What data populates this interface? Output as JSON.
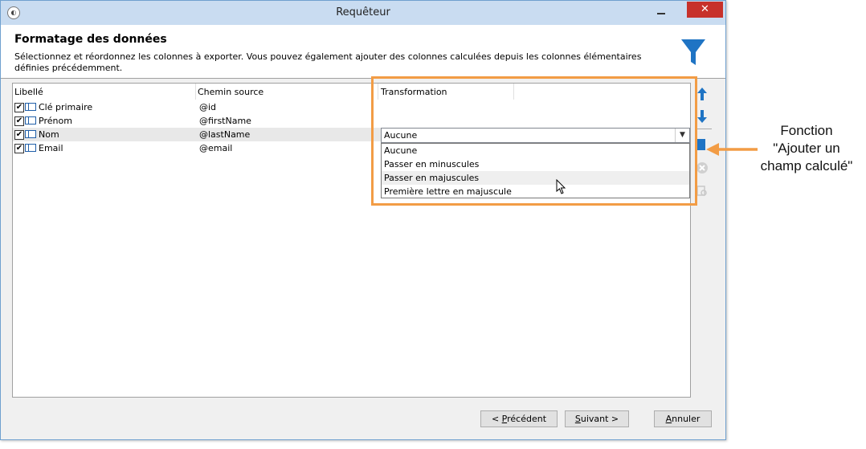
{
  "window": {
    "title": "Requêteur",
    "close_glyph": "✕"
  },
  "header": {
    "title": "Formatage des données",
    "description": "Sélectionnez et réordonnez les colonnes à exporter. Vous pouvez également ajouter des colonnes calculées depuis les colonnes élémentaires définies précédemment."
  },
  "grid": {
    "columns": [
      "Libellé",
      "Chemin source",
      "Transformation"
    ],
    "rows": [
      {
        "label": "Clé primaire",
        "path": "@id",
        "checked": true
      },
      {
        "label": "Prénom",
        "path": "@firstName",
        "checked": true
      },
      {
        "label": "Nom",
        "path": "@lastName",
        "checked": true
      },
      {
        "label": "Email",
        "path": "@email",
        "checked": true
      }
    ]
  },
  "transformation": {
    "selected": "Aucune",
    "options": [
      "Aucune",
      "Passer en minuscules",
      "Passer en majuscules",
      "Première lettre en majuscule"
    ],
    "hovered_index": 2
  },
  "buttons": {
    "prev_key": "P",
    "prev_rest": "récédent",
    "prev_prefix": "< ",
    "next_key": "S",
    "next_rest": "uivant >",
    "cancel_key": "A",
    "cancel_rest": "nnuler"
  },
  "annotation": {
    "line1": "Fonction",
    "line2": "\"Ajouter un",
    "line3": "champ calculé\""
  },
  "colors": {
    "accent": "#1f74c4",
    "highlight": "#f29c45",
    "close": "#c7312b"
  },
  "icons": [
    "move-up-icon",
    "move-down-icon",
    "add-computed-field-icon",
    "delete-icon",
    "detail-icon",
    "filter-icon"
  ]
}
